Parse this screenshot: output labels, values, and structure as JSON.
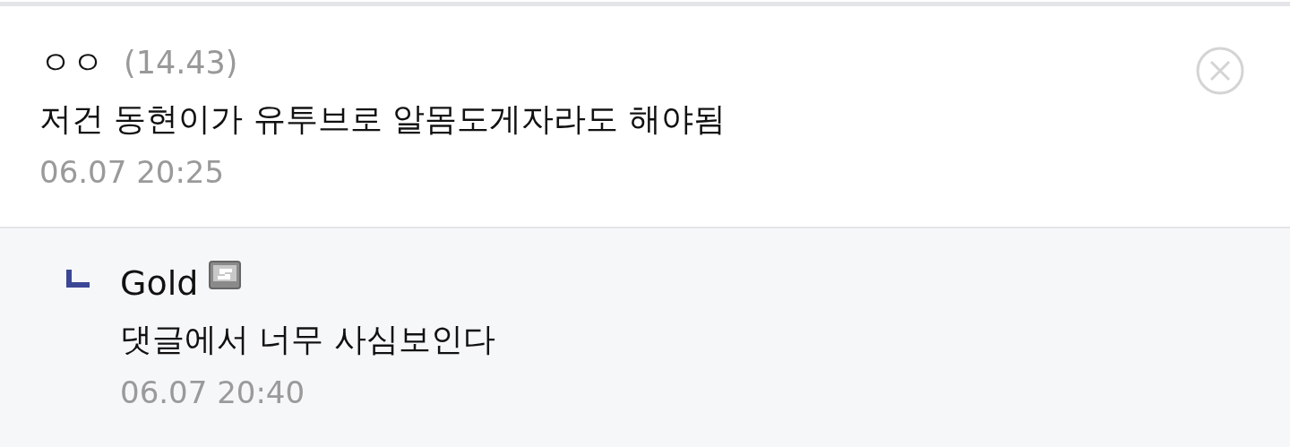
{
  "comment": {
    "author": "ㅇㅇ",
    "ip": "(14.43)",
    "text": "저건 동현이가 유투브로 알몸도게자라도 해야됨",
    "time": "06.07 20:25"
  },
  "replies": [
    {
      "author": "Gold",
      "text": "댓글에서 너무 사심보인다",
      "time": "06.07 20:40",
      "badge": true
    }
  ]
}
